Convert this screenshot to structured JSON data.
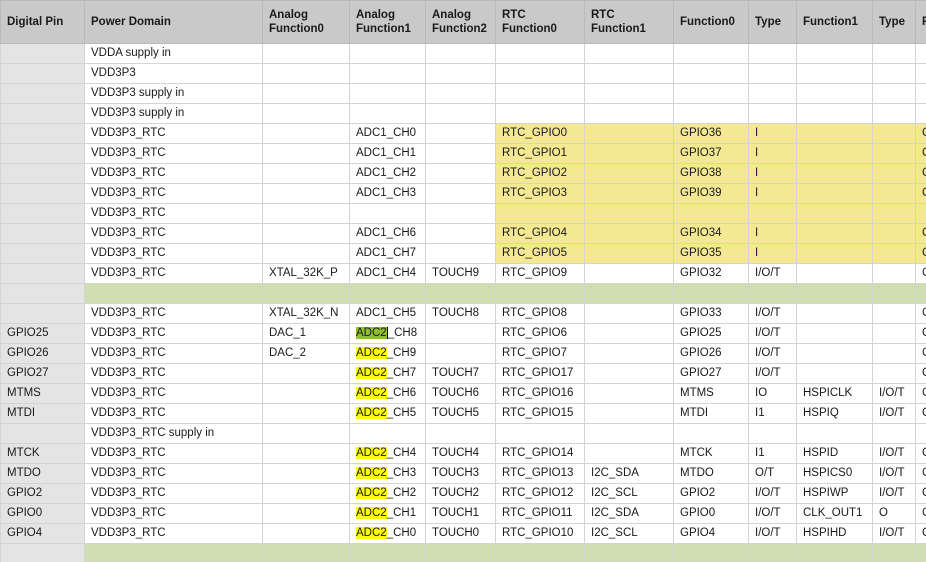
{
  "columns": [
    "Digital Pin",
    "Power Domain",
    "Analog\nFunction0",
    "Analog\nFunction1",
    "Analog\nFunction2",
    "RTC\nFunction0",
    "RTC\nFunction1",
    "Function0",
    "Type",
    "Function1",
    "Type",
    "F"
  ],
  "rows": [
    {
      "cells": [
        "",
        "VDDA supply in",
        "",
        "",
        "",
        "",
        "",
        "",
        "",
        "",
        "",
        ""
      ]
    },
    {
      "cells": [
        "",
        "VDD3P3",
        "",
        "",
        "",
        "",
        "",
        "",
        "",
        "",
        "",
        ""
      ]
    },
    {
      "cells": [
        "",
        "VDD3P3 supply in",
        "",
        "",
        "",
        "",
        "",
        "",
        "",
        "",
        "",
        ""
      ]
    },
    {
      "cells": [
        "",
        "VDD3P3 supply in",
        "",
        "",
        "",
        "",
        "",
        "",
        "",
        "",
        "",
        ""
      ]
    },
    {
      "cells": [
        "",
        "VDD3P3_RTC",
        "",
        "ADC1_CH0",
        "",
        "RTC_GPIO0",
        "",
        "GPIO36",
        "I",
        "",
        "",
        "C"
      ],
      "yellow": true
    },
    {
      "cells": [
        "",
        "VDD3P3_RTC",
        "",
        "ADC1_CH1",
        "",
        "RTC_GPIO1",
        "",
        "GPIO37",
        "I",
        "",
        "",
        "C"
      ],
      "yellow": true
    },
    {
      "cells": [
        "",
        "VDD3P3_RTC",
        "",
        "ADC1_CH2",
        "",
        "RTC_GPIO2",
        "",
        "GPIO38",
        "I",
        "",
        "",
        "C"
      ],
      "yellow": true
    },
    {
      "cells": [
        "",
        "VDD3P3_RTC",
        "",
        "ADC1_CH3",
        "",
        "RTC_GPIO3",
        "",
        "GPIO39",
        "I",
        "",
        "",
        "C"
      ],
      "yellow": true
    },
    {
      "cells": [
        "",
        "VDD3P3_RTC",
        "",
        "",
        "",
        "",
        "",
        "",
        "",
        "",
        "",
        ""
      ],
      "yellow": true
    },
    {
      "cells": [
        "",
        "VDD3P3_RTC",
        "",
        "ADC1_CH6",
        "",
        "RTC_GPIO4",
        "",
        "GPIO34",
        "I",
        "",
        "",
        "C"
      ],
      "yellow": true
    },
    {
      "cells": [
        "",
        "VDD3P3_RTC",
        "",
        "ADC1_CH7",
        "",
        "RTC_GPIO5",
        "",
        "GPIO35",
        "I",
        "",
        "",
        "C"
      ],
      "yellow": true
    },
    {
      "cells": [
        "",
        "VDD3P3_RTC",
        "XTAL_32K_P",
        "ADC1_CH4",
        "TOUCH9",
        "RTC_GPIO9",
        "",
        "GPIO32",
        "I/O/T",
        "",
        "",
        "C"
      ]
    },
    {
      "cells": [
        "",
        "",
        "",
        "",
        "",
        "",
        "",
        "",
        "",
        "",
        "",
        ""
      ],
      "green": true
    },
    {
      "cells": [
        "",
        "VDD3P3_RTC",
        "XTAL_32K_N",
        "ADC1_CH5",
        "TOUCH8",
        "RTC_GPIO8",
        "",
        "GPIO33",
        "I/O/T",
        "",
        "",
        "C"
      ]
    },
    {
      "cells": [
        "GPIO25",
        "VDD3P3_RTC",
        "DAC_1",
        "ADC2_CH8",
        "",
        "RTC_GPIO6",
        "",
        "GPIO25",
        "I/O/T",
        "",
        "",
        "C"
      ],
      "adc2": "sel"
    },
    {
      "cells": [
        "GPIO26",
        "VDD3P3_RTC",
        "DAC_2",
        "ADC2_CH9",
        "",
        "RTC_GPIO7",
        "",
        "GPIO26",
        "I/O/T",
        "",
        "",
        "C"
      ],
      "adc2": "hl"
    },
    {
      "cells": [
        "GPIO27",
        "VDD3P3_RTC",
        "",
        "ADC2_CH7",
        "TOUCH7",
        "RTC_GPIO17",
        "",
        "GPIO27",
        "I/O/T",
        "",
        "",
        "C"
      ],
      "adc2": "hl"
    },
    {
      "cells": [
        "MTMS",
        "VDD3P3_RTC",
        "",
        "ADC2_CH6",
        "TOUCH6",
        "RTC_GPIO16",
        "",
        "MTMS",
        "IO",
        "HSPICLK",
        "I/O/T",
        "C"
      ],
      "adc2": "hl"
    },
    {
      "cells": [
        "MTDI",
        "VDD3P3_RTC",
        "",
        "ADC2_CH5",
        "TOUCH5",
        "RTC_GPIO15",
        "",
        "MTDI",
        "I1",
        "HSPIQ",
        "I/O/T",
        "C"
      ],
      "adc2": "hl"
    },
    {
      "cells": [
        "",
        "VDD3P3_RTC supply in",
        "",
        "",
        "",
        "",
        "",
        "",
        "",
        "",
        "",
        ""
      ]
    },
    {
      "cells": [
        "MTCK",
        "VDD3P3_RTC",
        "",
        "ADC2_CH4",
        "TOUCH4",
        "RTC_GPIO14",
        "",
        "MTCK",
        "I1",
        "HSPID",
        "I/O/T",
        "C"
      ],
      "adc2": "hl"
    },
    {
      "cells": [
        "MTDO",
        "VDD3P3_RTC",
        "",
        "ADC2_CH3",
        "TOUCH3",
        "RTC_GPIO13",
        "I2C_SDA",
        "MTDO",
        "O/T",
        "HSPICS0",
        "I/O/T",
        "C"
      ],
      "adc2": "hl"
    },
    {
      "cells": [
        "GPIO2",
        "VDD3P3_RTC",
        "",
        "ADC2_CH2",
        "TOUCH2",
        "RTC_GPIO12",
        "I2C_SCL",
        "GPIO2",
        "I/O/T",
        "HSPIWP",
        "I/O/T",
        "C"
      ],
      "adc2": "hl"
    },
    {
      "cells": [
        "GPIO0",
        "VDD3P3_RTC",
        "",
        "ADC2_CH1",
        "TOUCH1",
        "RTC_GPIO11",
        "I2C_SDA",
        "GPIO0",
        "I/O/T",
        "CLK_OUT1",
        "O",
        "C"
      ],
      "adc2": "hl"
    },
    {
      "cells": [
        "GPIO4",
        "VDD3P3_RTC",
        "",
        "ADC2_CH0",
        "TOUCH0",
        "RTC_GPIO10",
        "I2C_SCL",
        "GPIO4",
        "I/O/T",
        "HSPIHD",
        "I/O/T",
        "C"
      ],
      "adc2": "hl"
    },
    {
      "cells": [
        "",
        "",
        "",
        "",
        "",
        "",
        "",
        "",
        "",
        "",
        "",
        ""
      ],
      "green": true
    }
  ],
  "colors": {
    "header_bg": "#c9c9c9",
    "pin_col_bg": "#e4e4e4",
    "yellow_fill": "#f5e893",
    "green_fill": "#cfdeb1",
    "text_highlight": "#ffff00",
    "selected_highlight": "#8fbe32"
  }
}
